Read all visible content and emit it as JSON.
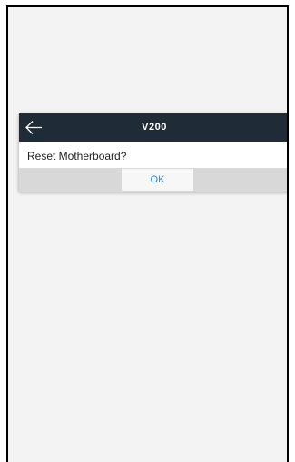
{
  "dialog": {
    "title": "V200",
    "message": "Reset Motherboard?",
    "ok_label": "OK",
    "back_icon": "arrow-left-icon"
  },
  "colors": {
    "header_bg": "#1f2b36",
    "page_bg": "#f3f3f3",
    "footer_bg": "#d8d8d8",
    "ok_text": "#2a8fd6"
  }
}
